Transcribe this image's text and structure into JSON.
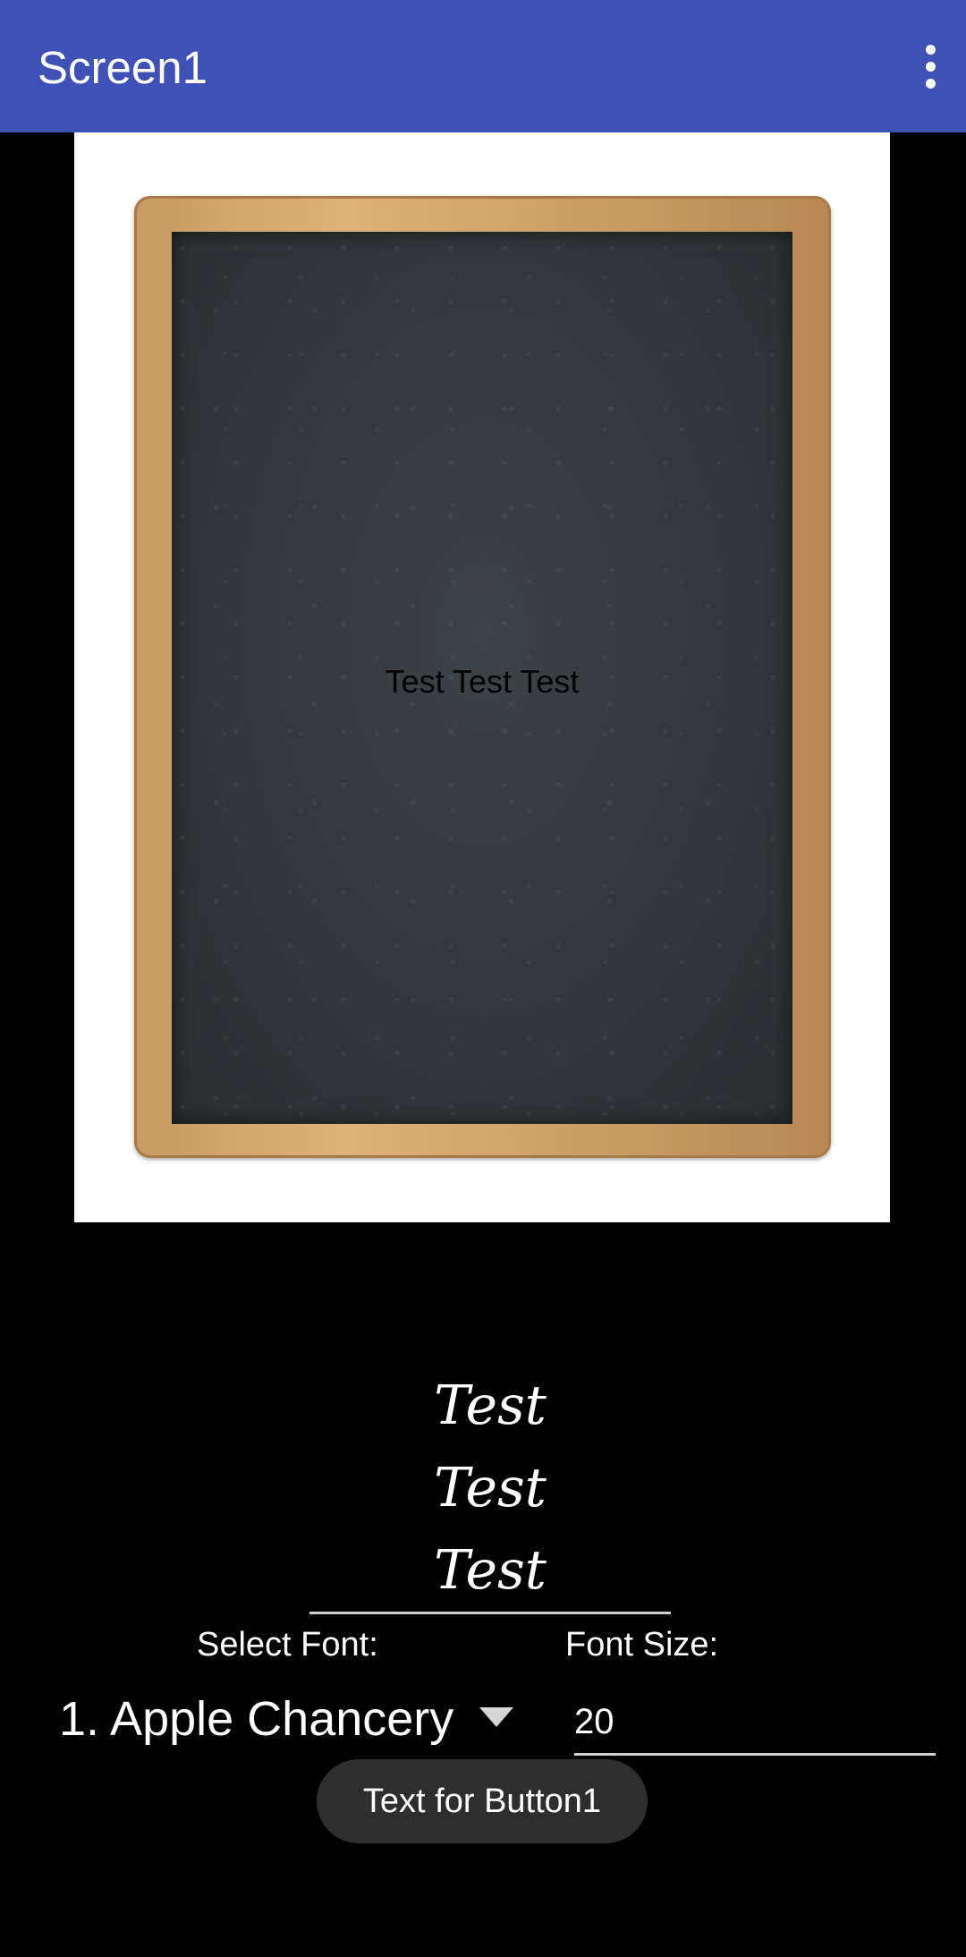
{
  "app_bar": {
    "title": "Screen1",
    "menu_icon": "more-vert-icon",
    "color": "#3F51B5"
  },
  "canvas": {
    "image": "chalkboard-image",
    "text": "Test Test Test"
  },
  "preview": {
    "lines": [
      "Test",
      "Test",
      "Test"
    ]
  },
  "controls": {
    "select_font_label": "Select Font:",
    "font_size_label": "Font Size:",
    "font_selected": "1. Apple Chancery",
    "font_size_value": "20",
    "button_label": "Text for Button1"
  }
}
